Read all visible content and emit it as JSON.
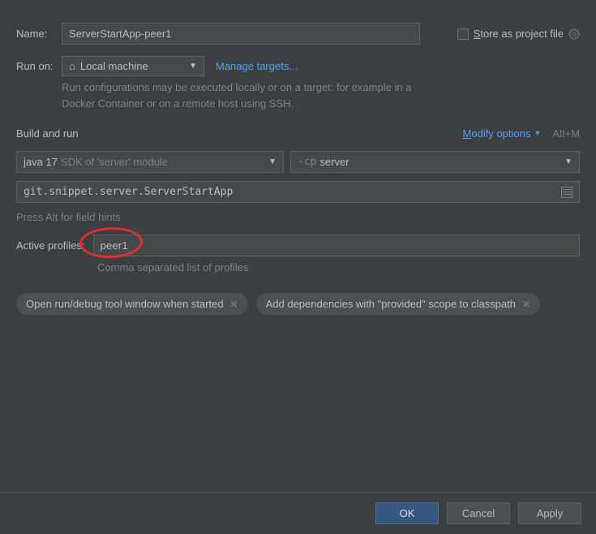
{
  "name": {
    "label": "Name:",
    "value": "ServerStartApp-peer1"
  },
  "store_as_project": "Store as project file",
  "run_on": {
    "label": "Run on:",
    "value": "Local machine",
    "manage_link": "Manage targets...",
    "hint": "Run configurations may be executed locally or on a target: for example in a Docker Container or on a remote host using SSH."
  },
  "build_and_run": {
    "title": "Build and run",
    "modify": "Modify options",
    "shortcut": "Alt+M",
    "jdk": {
      "main": "java 17",
      "sub": "SDK of 'server' module"
    },
    "cp": {
      "prefix": "-cp",
      "value": "server"
    },
    "main_class": "git.snippet.server.ServerStartApp",
    "field_hints": "Press Alt for field hints"
  },
  "profiles": {
    "label": "Active profiles:",
    "value": "peer1",
    "hint": "Comma separated list of profiles"
  },
  "chips": [
    "Open run/debug tool window when started",
    "Add dependencies with \"provided\" scope to classpath"
  ],
  "buttons": {
    "ok": "OK",
    "cancel": "Cancel",
    "apply": "Apply"
  }
}
